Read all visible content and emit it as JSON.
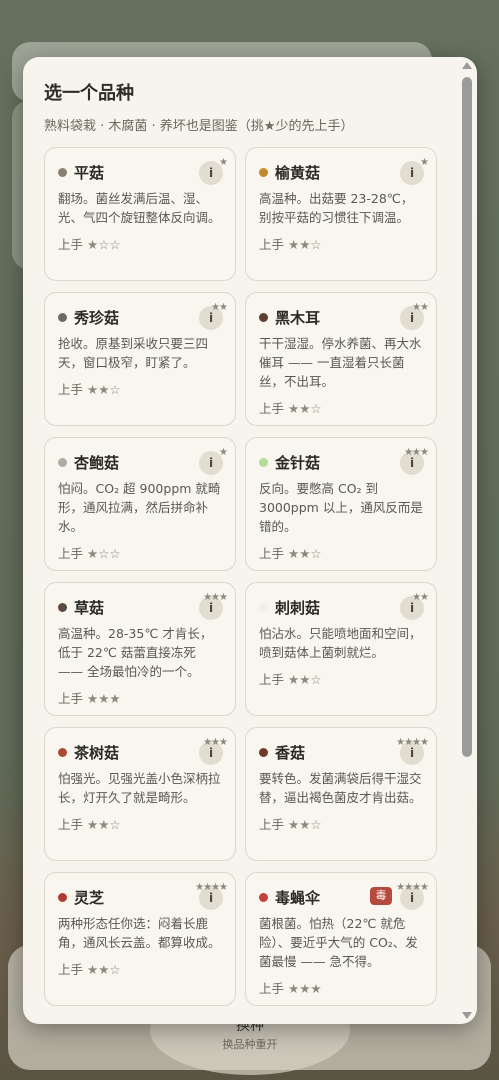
{
  "modal": {
    "title": "选一个品种",
    "subtitle": "熟料袋栽 · 木腐菌 · 养坏也是图鉴（挑★少的先上手）"
  },
  "level_label": "上手",
  "info_label": "i",
  "toxic_badge": "毒",
  "bottom_button": {
    "label": "换种",
    "sublabel": "换品种重开"
  },
  "varieties": [
    {
      "name": "平菇",
      "color": "#8a8070",
      "difficulty": "★",
      "desc": "翻场。菌丝发满后温、湿、光、气四个旋钮整体反向调。",
      "stars": "★☆☆"
    },
    {
      "name": "榆黄菇",
      "color": "#c08a2a",
      "difficulty": "★",
      "desc": "高温种。出菇要 23-28℃，别按平菇的习惯往下调温。",
      "stars": "★★☆"
    },
    {
      "name": "秀珍菇",
      "color": "#6e6a62",
      "difficulty": "★★",
      "desc": "抢收。原基到采收只要三四天，窗口极窄，盯紧了。",
      "stars": "★★☆"
    },
    {
      "name": "黑木耳",
      "color": "#5a3f33",
      "difficulty": "★★",
      "desc": "干干湿湿。停水养菌、再大水催耳 —— 一直湿着只长菌丝，不出耳。",
      "stars": "★★☆"
    },
    {
      "name": "杏鲍菇",
      "color": "#b0aca2",
      "difficulty": "★",
      "desc": "怕闷。CO₂ 超 900ppm 就畸形，通风拉满，然后拼命补水。",
      "stars": "★☆☆"
    },
    {
      "name": "金针菇",
      "color": "#b4dc96",
      "difficulty": "★★★",
      "desc": "反向。要憋高 CO₂ 到 3000ppm 以上，通风反而是错的。",
      "stars": "★★☆"
    },
    {
      "name": "草菇",
      "color": "#5a4a3e",
      "difficulty": "★★★",
      "desc": "高温种。28-35℃ 才肯长，低于 22℃ 菇蕾直接冻死 —— 全场最怕冷的一个。",
      "stars": "★★★"
    },
    {
      "name": "刺刺菇",
      "color": "#f0eee6",
      "difficulty": "★★",
      "desc": "怕沾水。只能喷地面和空间，喷到菇体上菌刺就烂。",
      "stars": "★★☆"
    },
    {
      "name": "茶树菇",
      "color": "#a84a36",
      "difficulty": "★★★",
      "desc": "怕强光。见强光盖小色深柄拉长，灯开久了就是畸形。",
      "stars": "★★☆"
    },
    {
      "name": "香菇",
      "color": "#6e3a2a",
      "difficulty": "★★★★",
      "desc": "要转色。发菌满袋后得干湿交替，逼出褐色菌皮才肯出菇。",
      "stars": "★★☆"
    },
    {
      "name": "灵芝",
      "color": "#b03a34",
      "difficulty": "★★★★",
      "desc": "两种形态任你选：闷着长鹿角，通风长云盖。都算收成。",
      "stars": "★★☆"
    },
    {
      "name": "毒蝇伞",
      "color": "#c0443a",
      "difficulty": "★★★★",
      "desc": "菌根菌。怕热（22℃ 就危险）、要近乎大气的 CO₂、发菌最慢 —— 急不得。",
      "stars": "★★★",
      "toxic": true
    }
  ]
}
